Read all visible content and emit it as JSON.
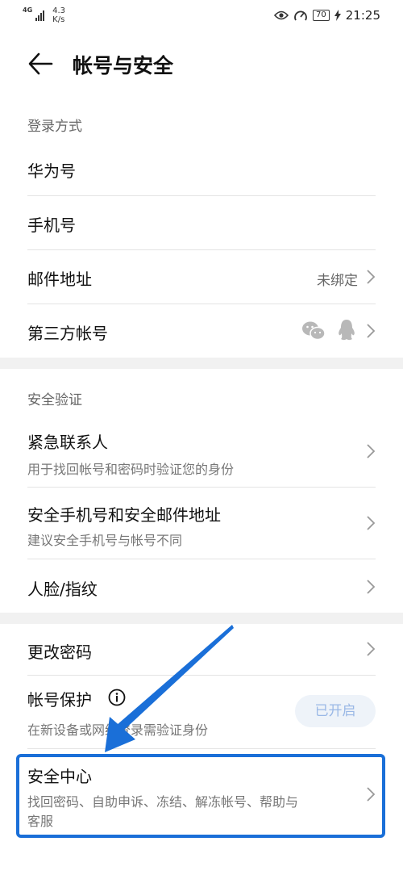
{
  "status_bar": {
    "network": "4G",
    "speed_value": "4.3",
    "speed_unit": "K/s",
    "battery": "70",
    "time": "21:25"
  },
  "header": {
    "title": "帐号与安全"
  },
  "login": {
    "section_title": "登录方式",
    "huawei_id": "华为号",
    "phone": "手机号",
    "email": {
      "label": "邮件地址",
      "value": "未绑定"
    },
    "third_party": "第三方帐号"
  },
  "security": {
    "section_title": "安全验证",
    "emergency": {
      "label": "紧急联系人",
      "sub": "用于找回帐号和密码时验证您的身份"
    },
    "secure_phone_email": {
      "label": "安全手机号和安全邮件地址",
      "sub": "建议安全手机号与帐号不同"
    },
    "face_fingerprint": "人脸/指纹"
  },
  "account": {
    "change_password": "更改密码",
    "protection": {
      "label": "帐号保护",
      "sub": "在新设备或网络登录需验证身份",
      "status": "已开启"
    },
    "security_center": {
      "label": "安全中心",
      "sub_line1": "找回密码、自助申诉、冻结、解冻帐号、帮助与",
      "sub_line2": "客服"
    }
  },
  "colors": {
    "accent": "#1a6fd8",
    "pill_text": "#9ab8e6"
  }
}
